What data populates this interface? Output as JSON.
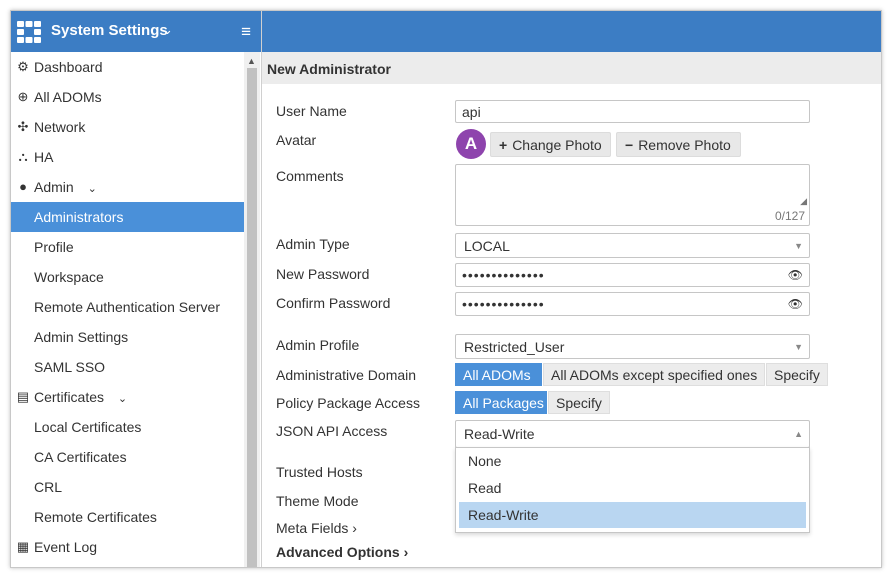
{
  "sidebar": {
    "title": "System Settings",
    "items": [
      {
        "label": "Dashboard",
        "icon": "dashboard-icon",
        "glyph": "⚙"
      },
      {
        "label": "All ADOMs",
        "icon": "globe-icon",
        "glyph": "⊕"
      },
      {
        "label": "Network",
        "icon": "network-icon",
        "glyph": "✣"
      },
      {
        "label": "HA",
        "icon": "ha-icon",
        "glyph": "⛬"
      },
      {
        "label": "Admin",
        "icon": "user-icon",
        "glyph": "●"
      },
      {
        "label": "Administrators"
      },
      {
        "label": "Profile"
      },
      {
        "label": "Workspace"
      },
      {
        "label": "Remote Authentication Server"
      },
      {
        "label": "Admin Settings"
      },
      {
        "label": "SAML SSO"
      },
      {
        "label": "Certificates",
        "icon": "certificate-icon",
        "glyph": "▤"
      },
      {
        "label": "Local Certificates"
      },
      {
        "label": "CA Certificates"
      },
      {
        "label": "CRL"
      },
      {
        "label": "Remote Certificates"
      },
      {
        "label": "Event Log",
        "icon": "event-log-icon",
        "glyph": "▦"
      }
    ]
  },
  "page": {
    "title": "New Administrator"
  },
  "form": {
    "user_name_label": "User Name",
    "user_name_value": "api",
    "avatar_label": "Avatar",
    "avatar_letter": "A",
    "change_photo": "Change Photo",
    "remove_photo": "Remove Photo",
    "comments_label": "Comments",
    "comments_counter": "0/127",
    "admin_type_label": "Admin Type",
    "admin_type_value": "LOCAL",
    "new_password_label": "New Password",
    "new_password_value": "••••••••••••••",
    "confirm_password_label": "Confirm Password",
    "confirm_password_value": "••••••••••••••",
    "admin_profile_label": "Admin Profile",
    "admin_profile_value": "Restricted_User",
    "admin_domain_label": "Administrative Domain",
    "admin_domain_options": [
      "All ADOMs",
      "All ADOMs except specified ones",
      "Specify"
    ],
    "policy_label": "Policy Package Access",
    "policy_options": [
      "All Packages",
      "Specify"
    ],
    "json_api_label": "JSON API Access",
    "json_api_value": "Read-Write",
    "json_api_options": [
      "None",
      "Read",
      "Read-Write"
    ],
    "trusted_hosts_label": "Trusted Hosts",
    "theme_mode_label": "Theme Mode",
    "meta_fields_label": "Meta Fields",
    "advanced_label": "Advanced Options"
  },
  "colors": {
    "brand": "#3c7dc4",
    "active": "#4a90d9",
    "avatar": "#8e44ad",
    "dropdown_selected": "#b9d6f1"
  }
}
